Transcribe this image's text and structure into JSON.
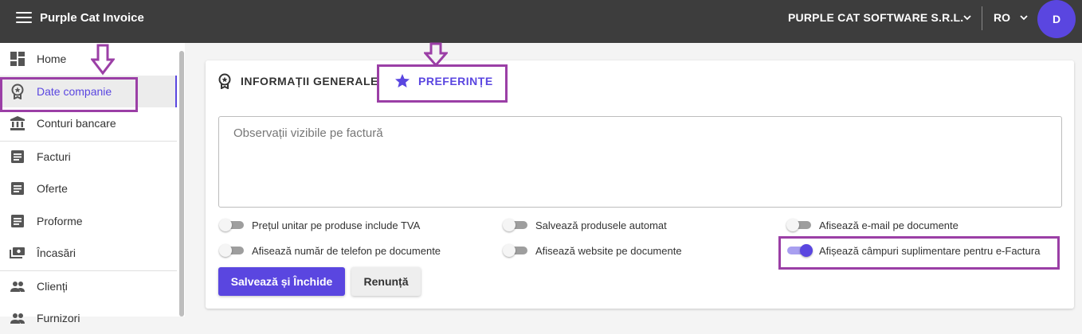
{
  "app": {
    "title": "Purple Cat Invoice"
  },
  "header": {
    "company": "PURPLE CAT SOFTWARE S.R.L.",
    "language": "RO",
    "avatar_initial": "D"
  },
  "sidebar": {
    "items": [
      {
        "label": "Home",
        "icon": "dashboard-icon"
      },
      {
        "label": "Date companie",
        "icon": "badge-icon",
        "active": true
      },
      {
        "label": "Conturi bancare",
        "icon": "bank-icon"
      },
      {
        "label": "Facturi",
        "icon": "document-icon"
      },
      {
        "label": "Oferte",
        "icon": "document-icon"
      },
      {
        "label": "Proforme",
        "icon": "document-icon"
      },
      {
        "label": "Încasări",
        "icon": "payments-icon"
      },
      {
        "label": "Clienți",
        "icon": "people-icon"
      },
      {
        "label": "Furnizori",
        "icon": "people-icon"
      }
    ]
  },
  "tabs": [
    {
      "label": "INFORMAȚII GENERALE",
      "icon": "badge-icon"
    },
    {
      "label": "PREFERINȚE",
      "icon": "star-icon",
      "active": true
    }
  ],
  "form": {
    "notes_placeholder": "Observații vizibile pe factură",
    "options": [
      {
        "label": "Prețul unitar pe produse include TVA",
        "checked": false
      },
      {
        "label": "Salvează produsele automat",
        "checked": false
      },
      {
        "label": "Afisează e-mail pe documente",
        "checked": false
      },
      {
        "label": "Afisează număr de telefon pe documente",
        "checked": false
      },
      {
        "label": "Afisează website pe documente",
        "checked": false
      },
      {
        "label": "Afișează câmpuri suplimentare pentru e-Factura",
        "checked": true
      }
    ],
    "save_label": "Salvează și Închide",
    "cancel_label": "Renunță"
  },
  "colors": {
    "accent": "#5a46e0",
    "highlight": "#9b3fa6",
    "topbar": "#3d3d3d"
  }
}
